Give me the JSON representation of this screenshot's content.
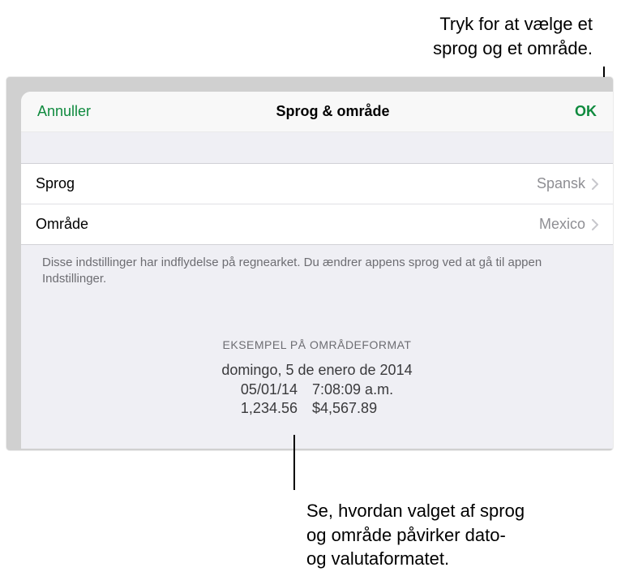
{
  "annotations": {
    "top_line1": "Tryk for at vælge et",
    "top_line2": "sprog og et område.",
    "bottom_line1": "Se, hvordan valget af sprog",
    "bottom_line2": "og område påvirker dato-",
    "bottom_line3": "og valutaformatet."
  },
  "modal": {
    "header": {
      "cancel_label": "Annuller",
      "title": "Sprog & område",
      "ok_label": "OK"
    },
    "rows": [
      {
        "label": "Sprog",
        "value": "Spansk"
      },
      {
        "label": "Område",
        "value": "Mexico"
      }
    ],
    "footer_text": "Disse indstillinger har indflydelse på regnearket. Du ændrer appens sprog ved at gå til appen Indstillinger.",
    "example": {
      "header": "EKSEMPEL PÅ OMRÅDEFORMAT",
      "full_date": "domingo, 5 de enero de 2014",
      "short_date": "05/01/14",
      "time": "7:08:09 a.m.",
      "number": "1,234.56",
      "currency": "$4,567.89"
    }
  },
  "colors": {
    "accent": "#0f8a3e",
    "secondary_text": "#8e8e93",
    "footer_text": "#6d6d72"
  }
}
